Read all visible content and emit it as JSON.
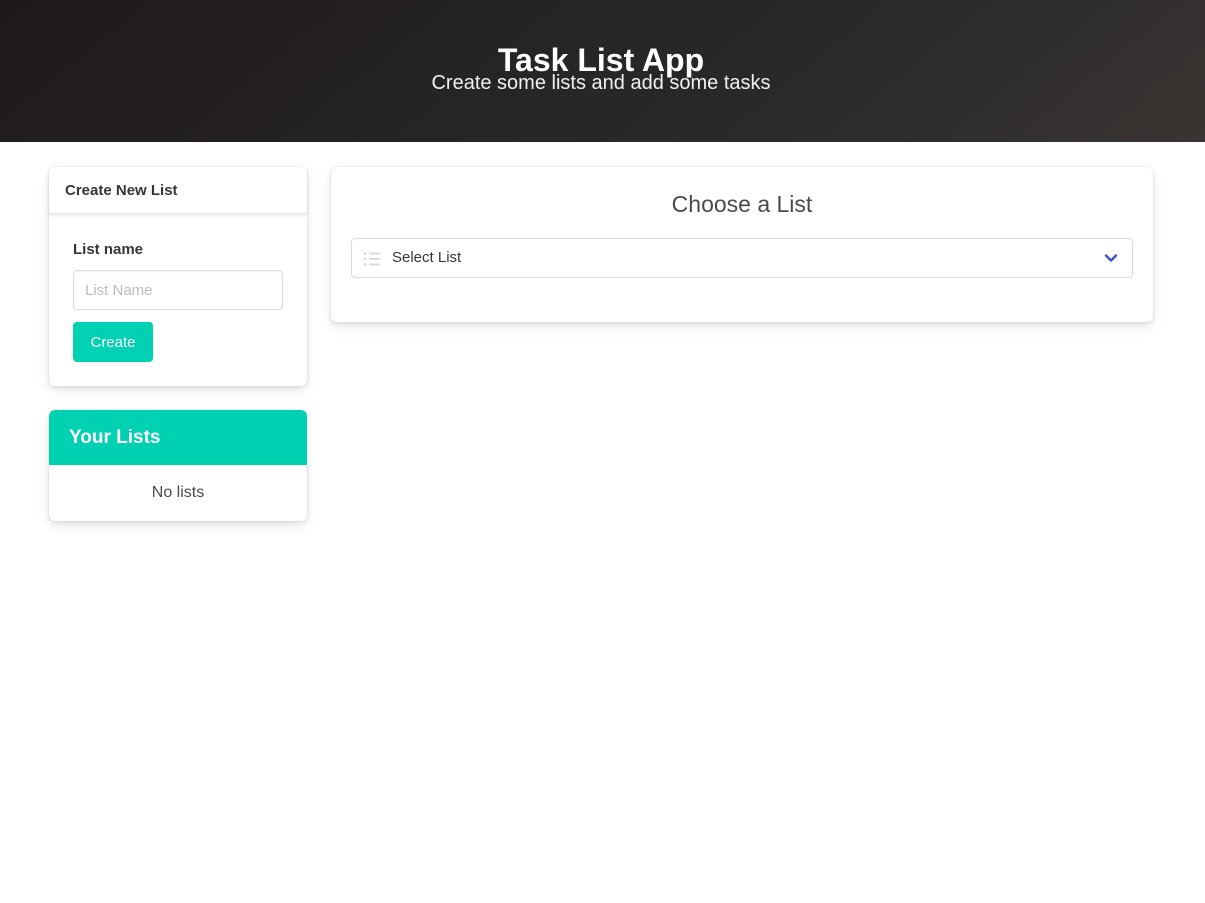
{
  "header": {
    "title": "Task List App",
    "subtitle": "Create some lists and add some tasks"
  },
  "create_list": {
    "title": "Create New List",
    "field_label": "List name",
    "input_placeholder": "List Name",
    "input_value": "",
    "button_label": "Create"
  },
  "your_lists": {
    "title": "Your Lists",
    "empty_text": "No lists"
  },
  "choose_list": {
    "title": "Choose a List",
    "select_value": "Select List",
    "select_icon": "list-icon",
    "dropdown_icon": "chevron-down-icon"
  },
  "colors": {
    "accent": "#00d1b2",
    "header_bg": "#2b2b2b",
    "chevron": "#3e56c4"
  }
}
